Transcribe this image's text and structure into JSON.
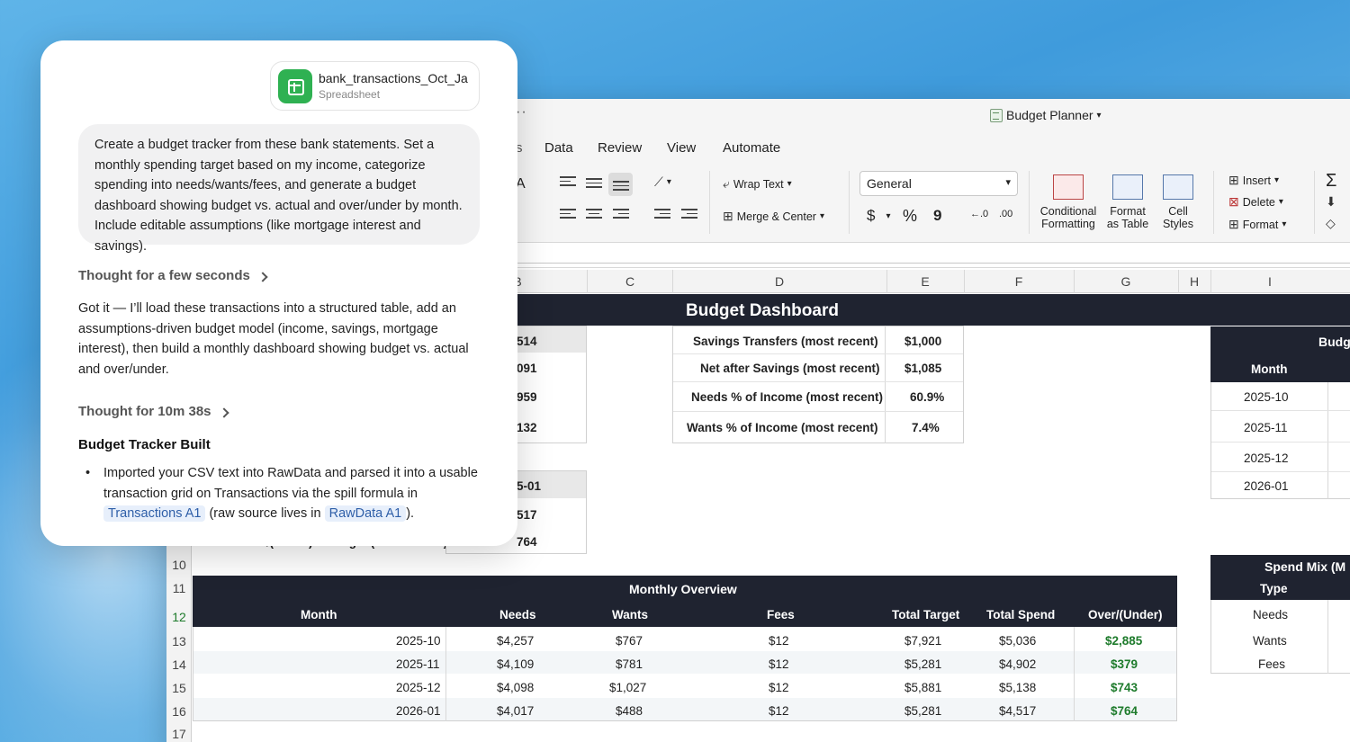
{
  "chat": {
    "attachment": {
      "name": "bank_transactions_Oct_Ja",
      "type": "Spreadsheet",
      "icon": "spreadsheet-icon"
    },
    "user_message": "Create a budget tracker from these bank statements. Set a monthly spending target based on my income, categorize spending into needs/wants/fees, and generate a budget dashboard showing budget vs. actual and over/under by month. Include editable assumptions (like mortgage interest and savings).",
    "thought_1": "Thought for a few seconds",
    "response": "Got it — I’ll load these transactions into a structured table, add an assumptions-driven budget model (income, savings, mortgage interest), then build a monthly dashboard showing budget vs. actual and over/under.",
    "thought_2": "Thought for 10m 38s",
    "section_title": "Budget Tracker Built",
    "bullet": {
      "t1": "Imported your CSV text into RawData and parsed it into a usable transaction grid on Transactions via the spill formula in",
      "chip1": "Transactions A1",
      "t2": "(raw source lives in",
      "chip2": "RawData A1",
      "t3": ")."
    }
  },
  "excel": {
    "title": "Budget Planner",
    "ellipsis": "··",
    "menu": [
      "Data",
      "Review",
      "View",
      "Automate"
    ],
    "ribbon": {
      "font_partial": "A",
      "wrap_text": "Wrap Text",
      "merge_center": "Merge & Center",
      "number_format": "General",
      "currency": "$",
      "percent": "%",
      "comma": "9",
      "dec_inc": "←.0",
      "dec_dec": ".00",
      "conditional_formatting_1": "Conditional",
      "conditional_formatting_2": "Formatting",
      "format_table_1": "Format",
      "format_table_2": "as Table",
      "cell_styles_1": "Cell",
      "cell_styles_2": "Styles",
      "insert": "Insert",
      "delete": "Delete",
      "format": "Format",
      "sum": "Σ"
    },
    "columns": [
      "B",
      "C",
      "D",
      "E",
      "F",
      "G",
      "H",
      "I"
    ],
    "rows": [
      "10",
      "11",
      "12",
      "13",
      "14",
      "15",
      "16",
      "17"
    ],
    "dashboard_title": "Budget Dashboard",
    "left_partial": [
      "514",
      "091",
      "959",
      "132"
    ],
    "left_partial_2": [
      "5-01",
      "517",
      "764"
    ],
    "row9_label_partial": "Over/(Under) to Target (most recent)",
    "metrics": [
      {
        "label": "Savings Transfers (most recent)",
        "value": "$1,000"
      },
      {
        "label": "Net after Savings (most recent)",
        "value": "$1,085"
      },
      {
        "label": "Needs % of Income (most recent)",
        "value": "60.9%"
      },
      {
        "label": "Wants % of Income (most recent)",
        "value": "7.4%"
      }
    ],
    "right_table": {
      "title_partial": "Budg",
      "header": "Month",
      "months": [
        "2025-10",
        "2025-11",
        "2025-12",
        "2026-01"
      ]
    },
    "spend_mix": {
      "title_partial": "Spend Mix (M",
      "header": "Type",
      "types": [
        "Needs",
        "Wants",
        "Fees"
      ]
    },
    "monthly_overview": {
      "title": "Monthly Overview",
      "headers": [
        "Month",
        "Needs",
        "Wants",
        "Fees",
        "Total Target",
        "Total Spend",
        "Over/(Under)"
      ],
      "rows": [
        [
          "2025-10",
          "$4,257",
          "$767",
          "$12",
          "$7,921",
          "$5,036",
          "$2,885"
        ],
        [
          "2025-11",
          "$4,109",
          "$781",
          "$12",
          "$5,281",
          "$4,902",
          "$379"
        ],
        [
          "2025-12",
          "$4,098",
          "$1,027",
          "$12",
          "$5,881",
          "$5,138",
          "$743"
        ],
        [
          "2026-01",
          "$4,017",
          "$488",
          "$12",
          "$5,281",
          "$4,517",
          "$764"
        ]
      ]
    }
  }
}
